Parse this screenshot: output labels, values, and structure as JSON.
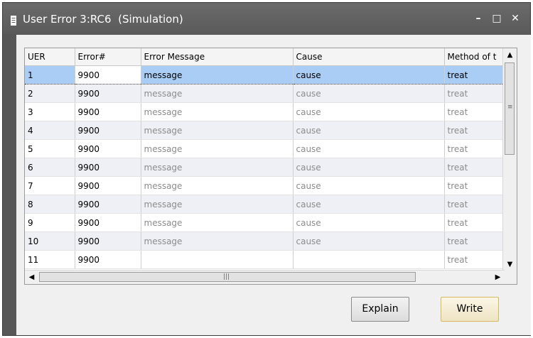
{
  "window": {
    "title": "User Error 3:RC6  (Simulation)",
    "minimize_glyph": "–",
    "maximize_glyph": "□",
    "close_glyph": "✕"
  },
  "table": {
    "columns": [
      "UER",
      "Error#",
      "Error Message",
      "Cause",
      "Method of t"
    ],
    "rows": [
      {
        "uer": "1",
        "error": "9900",
        "message": "message",
        "cause": "cause",
        "method": "treat"
      },
      {
        "uer": "2",
        "error": "9900",
        "message": "message",
        "cause": "cause",
        "method": "treat"
      },
      {
        "uer": "3",
        "error": "9900",
        "message": "message",
        "cause": "cause",
        "method": "treat"
      },
      {
        "uer": "4",
        "error": "9900",
        "message": "message",
        "cause": "cause",
        "method": "treat"
      },
      {
        "uer": "5",
        "error": "9900",
        "message": "message",
        "cause": "cause",
        "method": "treat"
      },
      {
        "uer": "6",
        "error": "9900",
        "message": "message",
        "cause": "cause",
        "method": "treat"
      },
      {
        "uer": "7",
        "error": "9900",
        "message": "message",
        "cause": "cause",
        "method": "treat"
      },
      {
        "uer": "8",
        "error": "9900",
        "message": "message",
        "cause": "cause",
        "method": "treat"
      },
      {
        "uer": "9",
        "error": "9900",
        "message": "message",
        "cause": "cause",
        "method": "treat"
      },
      {
        "uer": "10",
        "error": "9900",
        "message": "message",
        "cause": "cause",
        "method": "treat"
      },
      {
        "uer": "11",
        "error": "9900",
        "message": "",
        "cause": "",
        "method": "treat"
      }
    ],
    "selected_row": 0
  },
  "scrollbar": {
    "up_arrow": "▲",
    "down_arrow": "▼",
    "left_arrow": "◀",
    "right_arrow": "▶",
    "v_grip": "≡",
    "h_grip": "|||"
  },
  "buttons": {
    "explain": "Explain",
    "write": "Write"
  },
  "colors": {
    "title_bar": "#5e5e5e",
    "selected_row": "#a9cdf4",
    "write_border": "#d9b760"
  }
}
